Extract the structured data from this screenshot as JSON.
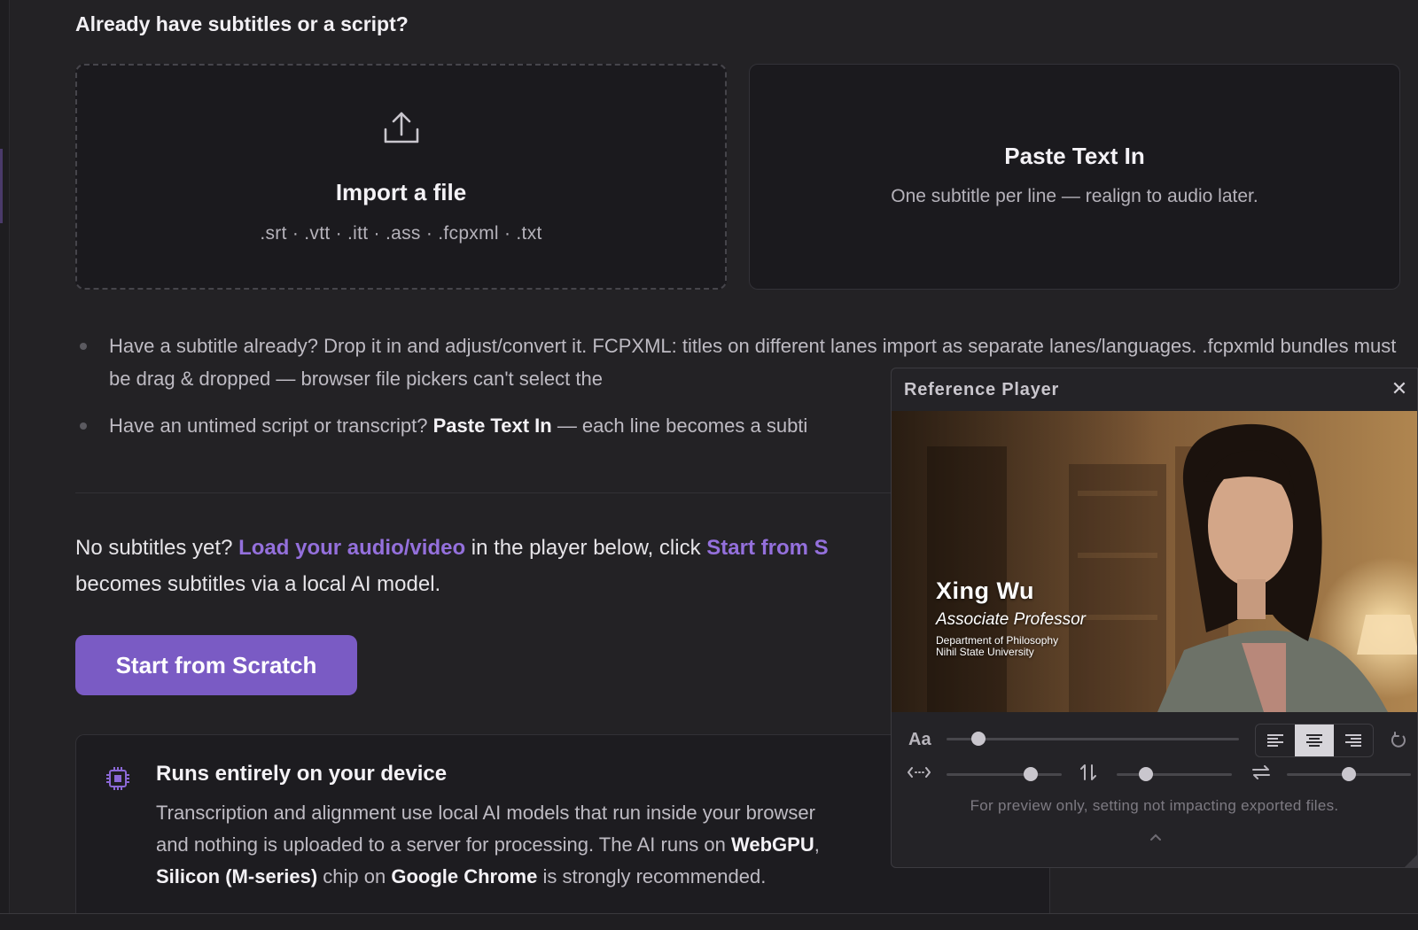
{
  "import_section": {
    "title": "Already have subtitles or a script?",
    "import_card": {
      "title": "Import a file",
      "formats": ".srt · .vtt · .itt · .ass · .fcpxml · .txt",
      "icon": "upload-icon"
    },
    "paste_card": {
      "title": "Paste Text In",
      "subtitle": "One subtitle per line — realign to audio later."
    }
  },
  "bullets": {
    "b1_text": "Have a subtitle already? Drop it in and adjust/convert it. FCPXML: titles on different lanes import as separate lanes/languages. .fcpxmld bundles must be drag & dropped — browser file pickers can't select the",
    "b2_pre": "Have an untimed script or transcript? ",
    "b2_bold": "Paste Text In",
    "b2_post": " — each line becomes a subti"
  },
  "intro": {
    "pre": "No subtitles yet? ",
    "link1": "Load your audio/video",
    "mid": " in the player below, click ",
    "link2": "Start from S",
    "post": "becomes subtitles via a local AI model."
  },
  "cta": {
    "label": "Start from Scratch"
  },
  "device": {
    "icon": "chip-icon",
    "title": "Runs entirely on your device",
    "body1": "Transcription and alignment use local AI models that run inside your browser",
    "body2": "and nothing is uploaded to a server for processing. The AI runs on ",
    "webgpu": "WebGPU",
    "body3": ",",
    "silicon": "Silicon (M-series)",
    "body4": " chip on ",
    "chrome": "Google Chrome",
    "body5": " is strongly recommended."
  },
  "player": {
    "title": "Reference Player",
    "close": "✕",
    "lower_third": {
      "name": "Xing Wu",
      "role": "Associate Professor",
      "department": "Department of Philosophy",
      "university": "Nihil State University"
    },
    "controls": {
      "font_label": "Aa",
      "font_size_level": 0.11,
      "horizontal_level": 0.73,
      "vertical_level": 0.25,
      "spacing_level": 0.5,
      "alignment_selected": "center",
      "preview_note": "For preview only, setting not impacting exported files."
    }
  },
  "colors": {
    "accent": "#7a5bc4",
    "link": "#9470dc",
    "background": "#232225"
  }
}
